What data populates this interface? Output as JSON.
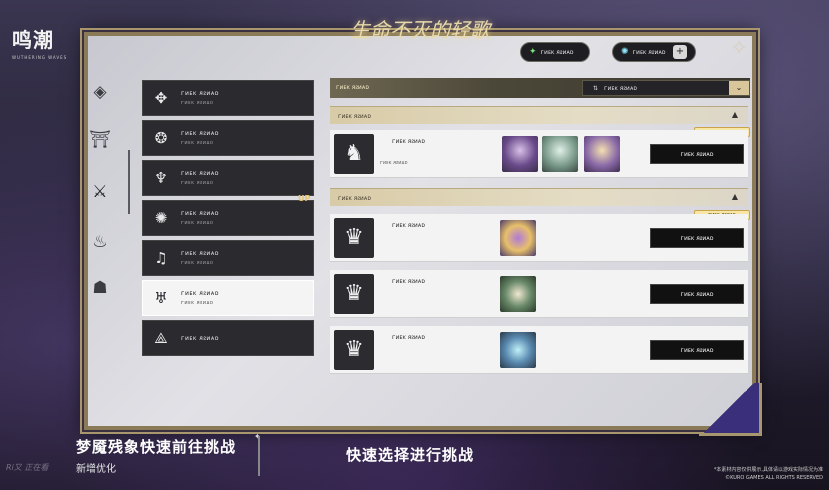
{
  "logo": {
    "title": "鸣潮",
    "subtitle": "WUTHERING WAVES"
  },
  "event_title": "生命不灭的轻歌",
  "currency": [
    {
      "icon": "green-gem-icon",
      "value": "ᴦᴎᴇᴋ ᴙᴤᴎᴀᴅ"
    },
    {
      "icon": "cyan-gem-icon",
      "value": "ᴦᴎᴇᴋ ᴙᴤᴎᴀᴅ",
      "add": "+"
    }
  ],
  "side_icons": [
    "diamond-rune-icon",
    "gate-rune-icon",
    "crossed-blades-icon",
    "flame-crest-icon",
    "beast-head-icon"
  ],
  "categories": [
    {
      "icon": "compass-star-icon",
      "l1": "ᴦᴎᴇᴋ ᴙᴤᴎᴀᴅ",
      "l2": "ᴦᴎᴇᴋ ᴙᴤᴎᴀᴅ"
    },
    {
      "icon": "octagon-sigil-icon",
      "l1": "ᴦᴎᴇᴋ ᴙᴤᴎᴀᴅ",
      "l2": "ᴦᴎᴇᴋ ᴙᴤᴎᴀᴅ"
    },
    {
      "icon": "flame-sigil-icon",
      "l1": "ᴦᴎᴇᴋ ᴙᴤᴎᴀᴅ",
      "l2": "ᴦᴎᴇᴋ ᴙᴤᴎᴀᴅ"
    },
    {
      "icon": "spark-sigil-icon",
      "l1": "ᴦᴎᴇᴋ ᴙᴤᴎᴀᴅ",
      "l2": "ᴦᴎᴇᴋ ᴙᴤᴎᴀᴅ"
    },
    {
      "icon": "harp-sigil-icon",
      "l1": "ᴦᴎᴇᴋ ᴙᴤᴎᴀᴅ",
      "l2": "ᴦᴎᴇᴋ ᴙᴤᴎᴀᴅ"
    },
    {
      "icon": "winged-sigil-icon",
      "l1": "ᴦᴎᴇᴋ ᴙᴤᴎᴀᴅ",
      "l2": "ᴦᴎᴇᴋ ᴙᴤᴎᴀᴅ"
    },
    {
      "icon": "triangle-sigil-icon",
      "l1": "ᴦᴎᴇᴋ ᴙᴤᴎᴀᴅ",
      "l2": ""
    }
  ],
  "up_label": "UP",
  "right_title": "ᴦᴎᴇᴋ ᴙᴤᴎᴀᴅ",
  "dropdown": {
    "label": "ᴦᴎᴇᴋ ᴙᴤᴎᴀᴅ",
    "arrow": "⌄"
  },
  "groups": [
    {
      "title": "ᴦᴎᴇᴋ ᴙᴤᴎᴀᴅ",
      "badge": "ᴦᴎᴇᴋ ᴙᴤᴎᴀᴅ",
      "rows": [
        {
          "name": "ᴦᴎᴇᴋ ᴙᴤᴎᴀᴅ",
          "sub": "ᴦᴎᴇᴋ ᴙᴤᴎᴀᴅ",
          "button": "ᴦᴎᴇᴋ ᴙᴤᴎᴀᴅ"
        }
      ]
    },
    {
      "title": "ᴦᴎᴇᴋ ᴙᴤᴎᴀᴅ",
      "badge": "ᴦᴎᴇᴋ ᴙᴤᴎᴀᴅ",
      "rows": [
        {
          "name": "ᴦᴎᴇᴋ ᴙᴤᴎᴀᴅ",
          "button": "ᴦᴎᴇᴋ ᴙᴤᴎᴀᴅ"
        },
        {
          "name": "ᴦᴎᴇᴋ ᴙᴤᴎᴀᴅ",
          "button": "ᴦᴎᴇᴋ ᴙᴤᴎᴀᴅ"
        },
        {
          "name": "ᴦᴎᴇᴋ ᴙᴤᴎᴀᴅ",
          "button": "ᴦᴎᴇᴋ ᴙᴤᴎᴀᴅ"
        }
      ]
    }
  ],
  "caption": {
    "main": "梦魇残象快速前往挑战",
    "sub": "新增优化",
    "center": "快速选择进行挑战"
  },
  "watermark": "Ri又 正在看",
  "disclaimer": "*本素材内容仅供展示,具体请以游戏实际情况为准 ©KURO GAMES ALL RIGHTS RESERVED"
}
